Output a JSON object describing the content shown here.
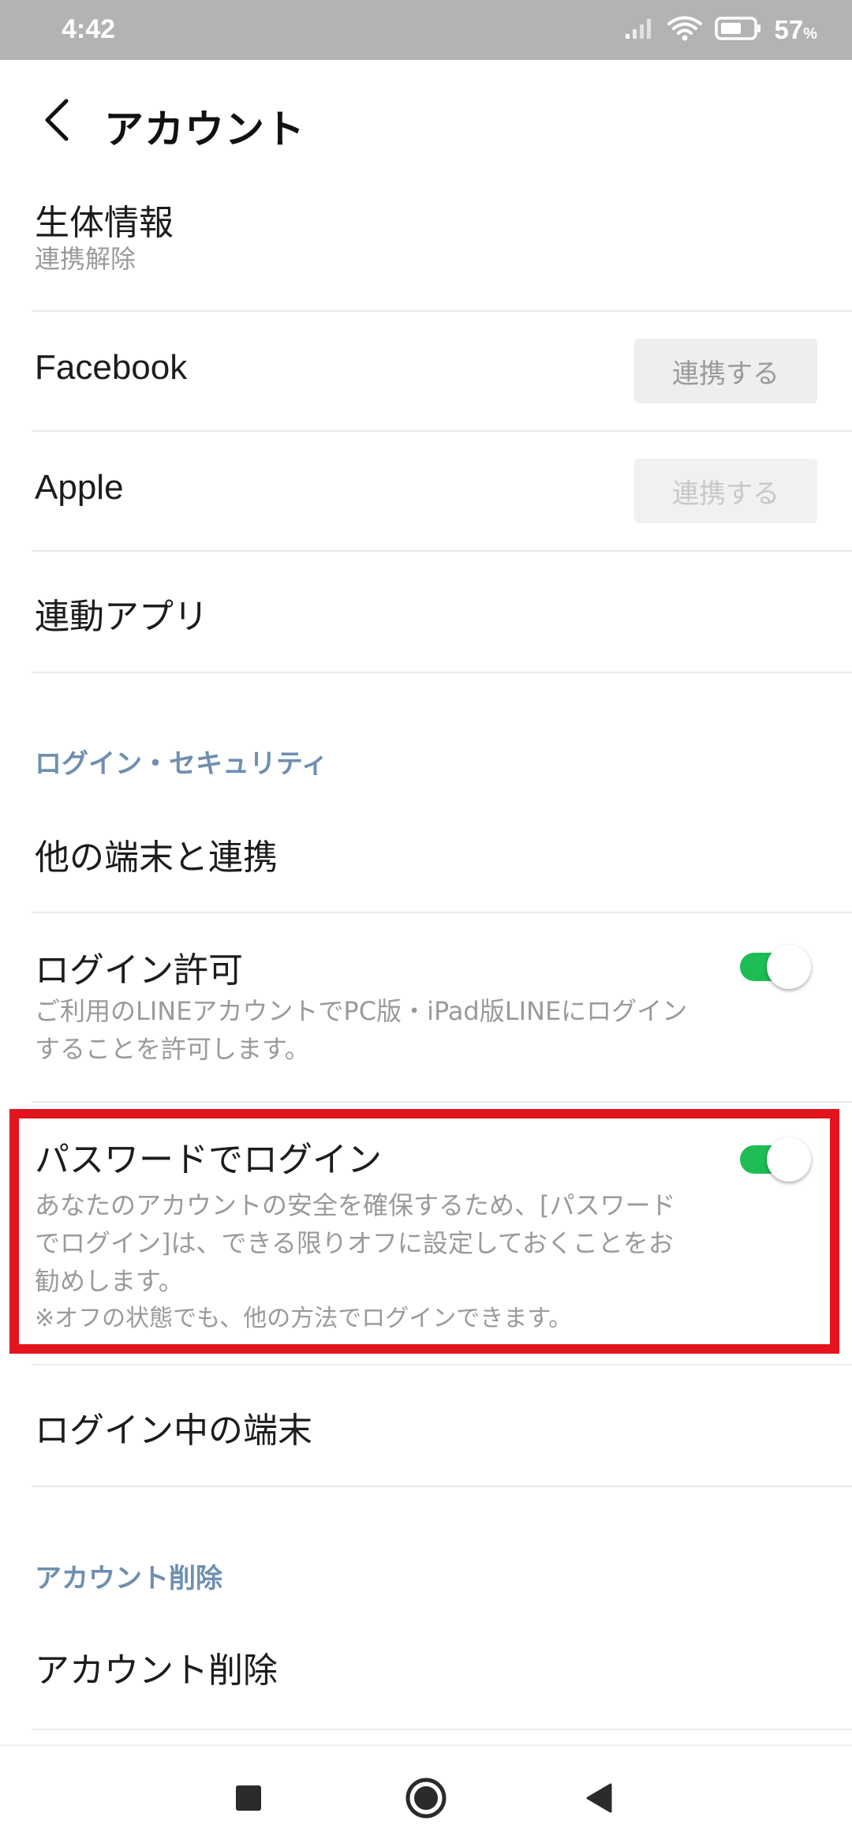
{
  "status_bar": {
    "time": "4:42",
    "battery_percent": "57",
    "battery_unit": "%",
    "icons": [
      "signal-icon",
      "wifi-icon",
      "battery-icon"
    ]
  },
  "header": {
    "title": "アカウント",
    "back_icon": "chevron-left-icon"
  },
  "biometrics": {
    "title": "生体情報",
    "subtitle": "連携解除"
  },
  "facebook": {
    "title": "Facebook",
    "button": "連携する"
  },
  "apple": {
    "title": "Apple",
    "button": "連携する"
  },
  "linked_apps": {
    "title": "連動アプリ"
  },
  "section_login_security": "ログイン・セキュリティ",
  "other_devices": {
    "title": "他の端末と連携"
  },
  "login_permission": {
    "title": "ログイン許可",
    "desc_line1": "ご利用のLINEアカウントでPC版・iPad版LINEにログイン",
    "desc_line2": "することを許可します。",
    "enabled": true
  },
  "password_login": {
    "title": "パスワードでログイン",
    "desc_line1": "あなたのアカウントの安全を確保するため、[パスワード",
    "desc_line2": "でログイン]は、できる限りオフに設定しておくことをお",
    "desc_line3": "勧めします。",
    "desc_line4": "※オフの状態でも、他の方法でログインできます。",
    "enabled": true
  },
  "logged_in_devices": {
    "title": "ログイン中の端末"
  },
  "section_delete": "アカウント削除",
  "delete_account": {
    "title": "アカウント削除"
  },
  "colors": {
    "toggle_on": "#1dbd54",
    "section_header": "#6f8fb0",
    "highlight": "#e3141d",
    "status_bar": "#b3b3b3"
  },
  "nav_icons": [
    "recent-apps-icon",
    "home-icon",
    "back-icon"
  ]
}
